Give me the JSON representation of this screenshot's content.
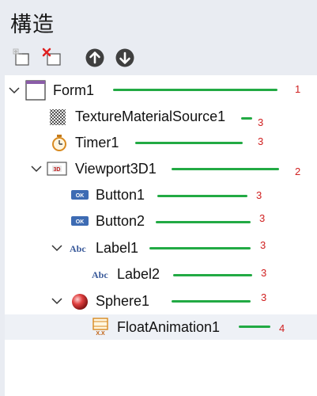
{
  "panel": {
    "title": "構造"
  },
  "toolbar": {
    "buttons": [
      {
        "icon": "add-component-icon"
      },
      {
        "icon": "delete-component-icon"
      },
      {
        "icon": "move-up-icon"
      },
      {
        "icon": "move-down-icon"
      }
    ]
  },
  "tree": {
    "items": [
      {
        "label": "Form1",
        "icon": "form-icon",
        "expanded": true,
        "annotation": "1"
      },
      {
        "label": "TextureMaterialSource1",
        "icon": "texture-icon",
        "annotation": "3"
      },
      {
        "label": "Timer1",
        "icon": "timer-icon",
        "annotation": "3"
      },
      {
        "label": "Viewport3D1",
        "icon": "viewport3d-icon",
        "expanded": true,
        "annotation": "2"
      },
      {
        "label": "Button1",
        "icon": "button-icon",
        "annotation": "3"
      },
      {
        "label": "Button2",
        "icon": "button-icon",
        "annotation": "3"
      },
      {
        "label": "Label1",
        "icon": "label-icon",
        "expanded": true,
        "annotation": "3"
      },
      {
        "label": "Label2",
        "icon": "label-icon",
        "annotation": "3"
      },
      {
        "label": "Sphere1",
        "icon": "sphere-icon",
        "expanded": true,
        "annotation": "3"
      },
      {
        "label": "FloatAnimation1",
        "icon": "float-animation-icon",
        "selected": true,
        "annotation": "4"
      }
    ]
  },
  "colors": {
    "annotation_line": "#22aa44",
    "annotation_number": "#d02020",
    "panel_bg": "#e9ecf2"
  }
}
